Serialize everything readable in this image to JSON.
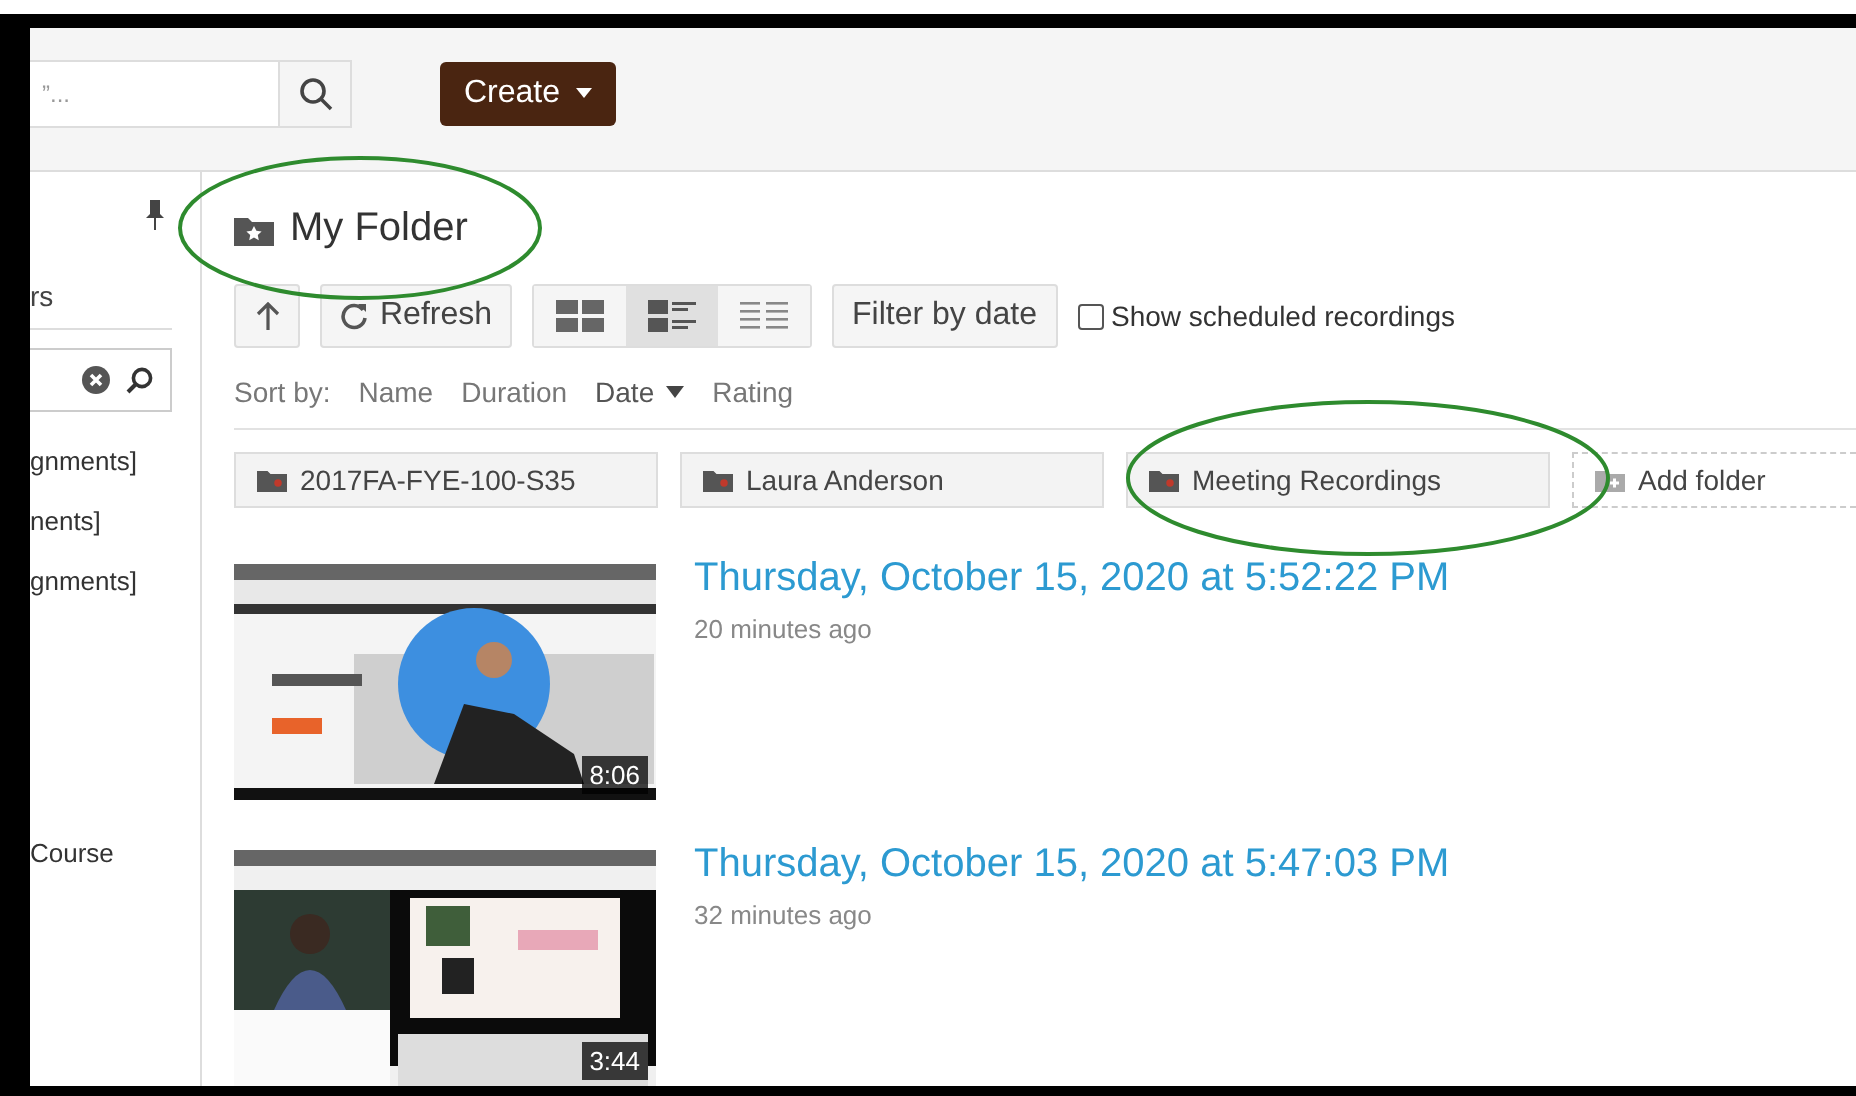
{
  "header": {
    "search": {
      "placeholder": "”..."
    },
    "create_button": "Create"
  },
  "sidebar": {
    "heading": "rs",
    "items": [
      "gnments]",
      "nents]",
      "gnments]",
      "Course"
    ]
  },
  "folder": {
    "title": "My Folder",
    "highlighted": true
  },
  "toolbar": {
    "refresh": "Refresh",
    "views": [
      {
        "kind": "grid",
        "selected": false
      },
      {
        "kind": "detail",
        "selected": true
      },
      {
        "kind": "list",
        "selected": false
      }
    ],
    "filter": "Filter by date",
    "scheduled": {
      "label": "Show scheduled recordings",
      "checked": false
    }
  },
  "sort": {
    "label": "Sort by:",
    "options": [
      {
        "label": "Name",
        "selected": false
      },
      {
        "label": "Duration",
        "selected": false
      },
      {
        "label": "Date",
        "selected": true
      },
      {
        "label": "Rating",
        "selected": false
      }
    ]
  },
  "folders": [
    {
      "name": "2017FA-FYE-100-S35",
      "highlighted": false
    },
    {
      "name": "Laura Anderson",
      "highlighted": false
    },
    {
      "name": "Meeting Recordings",
      "highlighted": true
    }
  ],
  "add_folder": "Add folder",
  "recordings": [
    {
      "title": "Thursday, October 15, 2020 at 5:52:22 PM",
      "age": "20 minutes ago",
      "duration": "8:06",
      "kind": "picture"
    },
    {
      "title": "Thursday, October 15, 2020 at 5:47:03 PM",
      "age": "32 minutes ago",
      "duration": "3:44",
      "kind": "picture"
    }
  ]
}
